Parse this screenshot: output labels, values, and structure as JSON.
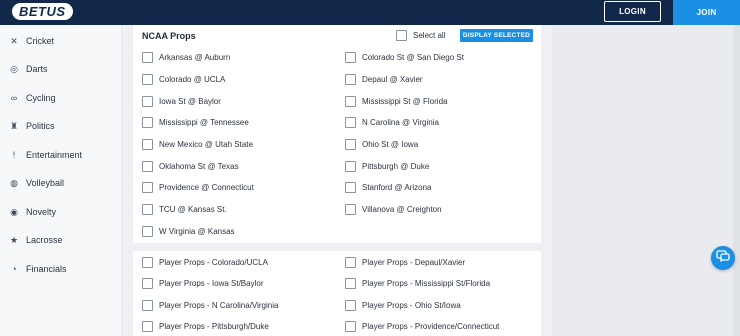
{
  "header": {
    "logo_text": "BETUS",
    "login_label": "LOGIN",
    "join_label": "JOIN"
  },
  "sidebar": {
    "items": [
      {
        "label": "Cricket",
        "icon": "cricket-icon"
      },
      {
        "label": "Darts",
        "icon": "darts-icon"
      },
      {
        "label": "Cycling",
        "icon": "cycling-icon"
      },
      {
        "label": "Politics",
        "icon": "politics-icon"
      },
      {
        "label": "Entertainment",
        "icon": "entertainment-icon"
      },
      {
        "label": "Volleyball",
        "icon": "volleyball-icon"
      },
      {
        "label": "Novelty",
        "icon": "novelty-icon"
      },
      {
        "label": "Lacrosse",
        "icon": "lacrosse-icon"
      },
      {
        "label": "Financials",
        "icon": "financials-icon"
      }
    ]
  },
  "ncaa_panel": {
    "title": "NCAA Props",
    "select_all_label": "Select all",
    "display_selected_label": "DISPLAY SELECTED",
    "left_options": [
      "Arkansas @ Auburn",
      "Colorado @ UCLA",
      "Iowa St @ Baylor",
      "Mississippi @ Tennessee",
      "New Mexico @ Utah State",
      "Oklahoma St @ Texas",
      "Providence @ Connecticut",
      "TCU @ Kansas St.",
      "W Virginia @ Kansas"
    ],
    "right_options": [
      "Colorado St @ San Diego St",
      "Depaul @ Xavier",
      "Mississippi St @ Florida",
      "N Carolina @ Virginia",
      "Ohio St @ Iowa",
      "Pittsburgh @ Duke",
      "Stanford @ Arizona",
      "Villanova @ Creighton"
    ]
  },
  "player_panel": {
    "left_options": [
      "Player Props - Colorado/UCLA",
      "Player Props - Iowa St/Baylor",
      "Player Props - N Carolina/Virginia",
      "Player Props - Pittsburgh/Duke"
    ],
    "right_options": [
      "Player Props - Depaul/Xavier",
      "Player Props - Mississippi St/Florida",
      "Player Props - Ohio St/Iowa",
      "Player Props - Providence/Connecticut"
    ]
  },
  "colors": {
    "header_bg": "#11284b",
    "accent": "#1a8fe3"
  }
}
